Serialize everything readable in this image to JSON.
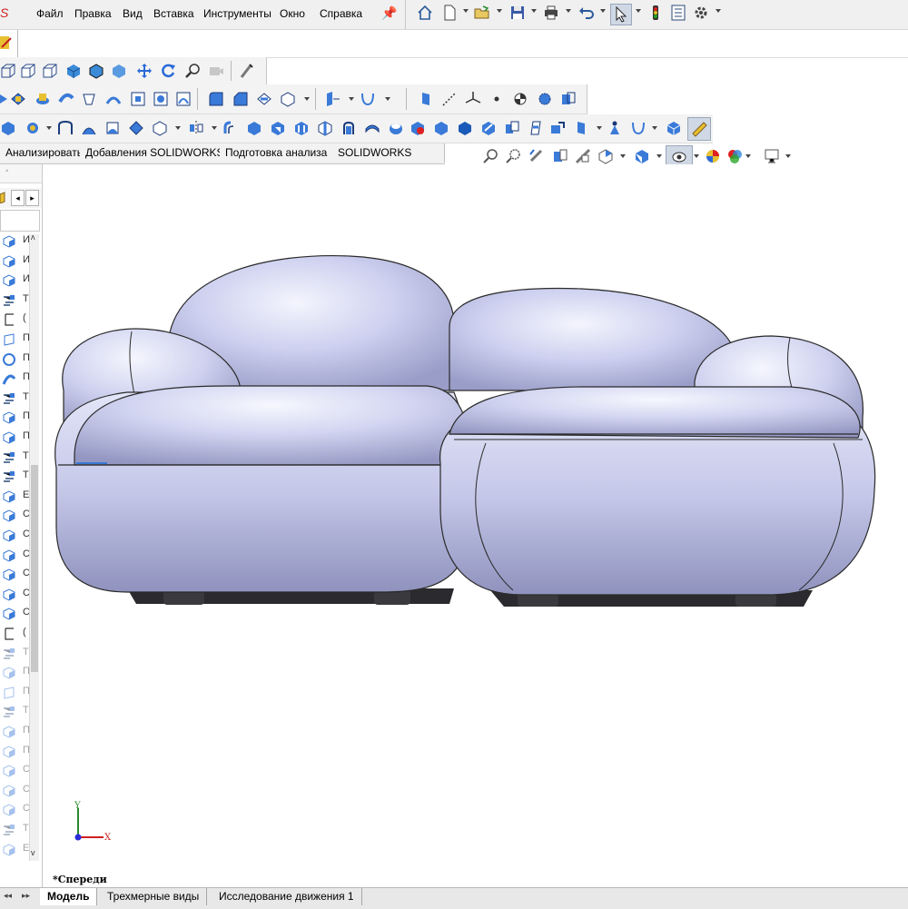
{
  "app": {
    "logo": "S"
  },
  "menu": {
    "items": [
      "Файл",
      "Правка",
      "Вид",
      "Вставка",
      "Инструменты",
      "Окно",
      "Справка"
    ]
  },
  "quick_access": {
    "icons": [
      "home-icon",
      "new-document-icon",
      "open-icon",
      "save-icon",
      "print-icon",
      "undo-icon",
      "select-icon",
      "rebuild-icon",
      "file-properties-icon",
      "options-icon"
    ]
  },
  "command_tabs": [
    "Анализировать",
    "Добавления SOLIDWORKS",
    "Подготовка анализа",
    "SOLIDWORKS Plastics"
  ],
  "bottom_tabs": [
    "Модель",
    "Трехмерные виды",
    "Исследование движения 1"
  ],
  "viewport": {
    "view_label": "*Спереди",
    "triad": {
      "x": "X",
      "y": "Y"
    }
  },
  "feature_tree": {
    "items": [
      {
        "text": "И",
        "icon": "part-icon"
      },
      {
        "text": "И",
        "icon": "part-icon"
      },
      {
        "text": "И",
        "icon": "part-icon"
      },
      {
        "text": "Т",
        "icon": "feature-icon"
      },
      {
        "text": "(",
        "icon": "sketch-icon"
      },
      {
        "text": "П",
        "icon": "plane-icon"
      },
      {
        "text": "П",
        "icon": "revolve-icon"
      },
      {
        "text": "П",
        "icon": "sweep-icon"
      },
      {
        "text": "Т",
        "icon": "feature-icon"
      },
      {
        "text": "П",
        "icon": "fillet-icon"
      },
      {
        "text": "П",
        "icon": "boss-icon"
      },
      {
        "text": "Т",
        "icon": "feature-icon"
      },
      {
        "text": "Т",
        "icon": "feature-icon"
      },
      {
        "text": "Е",
        "icon": "part-icon"
      },
      {
        "text": "С",
        "icon": "body-icon"
      },
      {
        "text": "С",
        "icon": "body-icon"
      },
      {
        "text": "С",
        "icon": "body-icon"
      },
      {
        "text": "С",
        "icon": "body-icon"
      },
      {
        "text": "С",
        "icon": "body-icon"
      },
      {
        "text": "С",
        "icon": "body-icon"
      },
      {
        "text": "(",
        "icon": "sketch-icon"
      },
      {
        "text": "Т",
        "icon": "feature-icon",
        "dim": true
      },
      {
        "text": "П",
        "icon": "boss-icon",
        "dim": true
      },
      {
        "text": "П",
        "icon": "plane-icon",
        "dim": true
      },
      {
        "text": "Т",
        "icon": "feature-icon",
        "dim": true
      },
      {
        "text": "П",
        "icon": "fillet-icon",
        "dim": true
      },
      {
        "text": "П",
        "icon": "boss-icon",
        "dim": true
      },
      {
        "text": "С",
        "icon": "body-icon",
        "dim": true
      },
      {
        "text": "С",
        "icon": "body-icon",
        "dim": true
      },
      {
        "text": "С",
        "icon": "body-icon",
        "dim": true
      },
      {
        "text": "Т",
        "icon": "feature-icon",
        "dim": true
      },
      {
        "text": "Е",
        "icon": "part-icon",
        "dim": true
      }
    ]
  },
  "colors": {
    "model_fill": "#c9cbeb",
    "model_edge": "#2a2a2a",
    "accent": "#2a6bd1"
  }
}
